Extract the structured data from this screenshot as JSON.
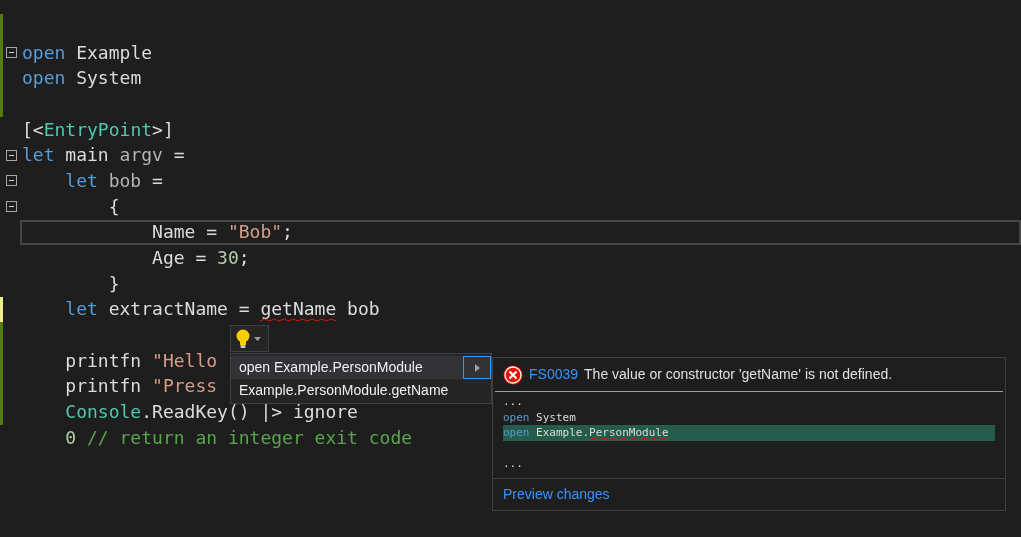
{
  "code_lines": [
    {
      "fold": false,
      "current": false,
      "color": "#587c0c"
    },
    {
      "tokens": [
        {
          "kind": "keyword",
          "text": "open"
        },
        {
          "kind": "ident",
          "text": " Example"
        }
      ],
      "fold": true,
      "current": false,
      "color": "#587c0c"
    },
    {
      "tokens": [
        {
          "kind": "keyword",
          "text": "open"
        },
        {
          "kind": "ident",
          "text": " System"
        }
      ],
      "fold": false,
      "current": false,
      "color": "#587c0c"
    },
    {
      "fold": false,
      "current": false,
      "color": "#587c0c"
    },
    {
      "tokens": [
        {
          "kind": "punct",
          "text": "[<"
        },
        {
          "kind": "type",
          "text": "EntryPoint"
        },
        {
          "kind": "punct",
          "text": ">]"
        }
      ],
      "fold": false,
      "current": false
    },
    {
      "tokens": [
        {
          "kind": "keyword",
          "text": "let"
        },
        {
          "kind": "ident",
          "text": " main"
        },
        {
          "kind": "param",
          "text": " argv"
        },
        {
          "kind": "punct",
          "text": " ="
        }
      ],
      "fold": true,
      "current": false
    },
    {
      "tokens": [
        {
          "kind": "keyword",
          "text": "    let"
        },
        {
          "kind": "param",
          "text": " bob"
        },
        {
          "kind": "punct",
          "text": " ="
        }
      ],
      "fold": true,
      "current": false
    },
    {
      "tokens": [
        {
          "kind": "punct",
          "text": "        {"
        }
      ],
      "fold": true,
      "current": false
    },
    {
      "tokens": [
        {
          "kind": "ident",
          "text": "            Name = "
        },
        {
          "kind": "string",
          "text": "\"Bob\""
        },
        {
          "kind": "punct",
          "text": ";"
        }
      ],
      "fold": false,
      "current": true
    },
    {
      "tokens": [
        {
          "kind": "ident",
          "text": "            Age = "
        },
        {
          "kind": "number",
          "text": "30"
        },
        {
          "kind": "punct",
          "text": ";"
        }
      ],
      "fold": false,
      "current": false
    },
    {
      "tokens": [
        {
          "kind": "punct",
          "text": "        }"
        }
      ],
      "fold": false,
      "current": false
    },
    {
      "tokens": [
        {
          "kind": "keyword",
          "text": "    let"
        },
        {
          "kind": "ident",
          "text": " extractName = "
        },
        {
          "kind": "error",
          "text": "getName"
        },
        {
          "kind": "ident",
          "text": " bob"
        }
      ],
      "fold": false,
      "current": false,
      "color": "#efef91"
    },
    {
      "fold": false,
      "current": false,
      "color": "#587c0c"
    },
    {
      "tokens": [
        {
          "kind": "ident",
          "text": "    printfn "
        },
        {
          "kind": "string",
          "text": "\"Hello "
        }
      ],
      "fold": false,
      "current": false,
      "color": "#587c0c"
    },
    {
      "tokens": [
        {
          "kind": "ident",
          "text": "    printfn "
        },
        {
          "kind": "string",
          "text": "\"Press "
        }
      ],
      "fold": false,
      "current": false,
      "color": "#587c0c"
    },
    {
      "tokens": [
        {
          "kind": "type",
          "text": "    Console"
        },
        {
          "kind": "ident",
          "text": ".ReadKey() |> ignore"
        }
      ],
      "fold": false,
      "current": false,
      "color": "#587c0c"
    },
    {
      "tokens": [
        {
          "kind": "number",
          "text": "    0"
        },
        {
          "kind": "comment",
          "text": " // return an integer exit code"
        }
      ],
      "fold": false,
      "current": false
    }
  ],
  "quick_actions": [
    {
      "label": "open Example.PersonModule",
      "selected": true
    },
    {
      "label": "Example.PersonModule.getName",
      "selected": false
    }
  ],
  "preview": {
    "code": "FS0039",
    "message": "The value or constructor 'getName' is not defined.",
    "lines": [
      {
        "tokens": [
          {
            "kind": "punct",
            "text": "..."
          }
        ],
        "highlighted": false
      },
      {
        "tokens": [
          {
            "kind": "keyword",
            "text": "open"
          },
          {
            "kind": "ident",
            "text": " System"
          }
        ],
        "highlighted": false
      },
      {
        "tokens": [
          {
            "kind": "keyword",
            "text": "open"
          },
          {
            "kind": "ident",
            "text": " Example."
          },
          {
            "kind": "error",
            "text": "PersonModule"
          }
        ],
        "highlighted": true
      },
      {
        "highlighted": false
      },
      {
        "tokens": [
          {
            "kind": "punct",
            "text": "..."
          }
        ],
        "highlighted": false
      }
    ],
    "link": "Preview changes"
  }
}
